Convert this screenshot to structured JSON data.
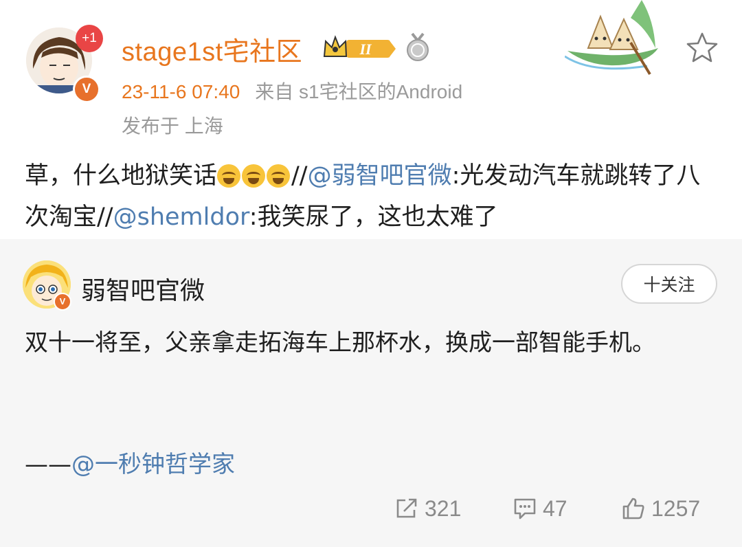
{
  "post": {
    "author": "stage1st宅社区",
    "notification_count": "+1",
    "verified_mark": "V",
    "time": "23-11-6 07:40",
    "source": "来自 s1宅社区的Android",
    "location": "发布于 上海",
    "content": {
      "part1": "草，什么地狱笑话",
      "emojis": [
        "laugh-cry-emoji",
        "laugh-cry-emoji",
        "laugh-cry-emoji"
      ],
      "sep1": "//",
      "mention1": "@弱智吧官微",
      "part2": ":光发动汽车就跳转了八次淘宝",
      "sep2": "//",
      "mention2": "@shemldor",
      "part3": ":我笑尿了，这也太难了"
    }
  },
  "repost": {
    "author": "弱智吧官微",
    "follow_label": "十关注",
    "text": "双十一将至，父亲拿走拓海车上那杯水，换成一部智能手机。",
    "sign_prefix": "——",
    "sign_mention": "@一秒钟哲学家",
    "actions": {
      "share_count": "321",
      "comment_count": "47",
      "like_count": "1257"
    }
  },
  "icons": [
    "crown-level-badge-icon",
    "medal-icon",
    "star-favorite-icon",
    "share-icon",
    "comment-icon",
    "like-icon"
  ],
  "colors": {
    "username": "#e8761e",
    "mention": "#4f7db0",
    "meta_gray": "#9a9a9a",
    "repost_bg": "#f6f6f6"
  }
}
